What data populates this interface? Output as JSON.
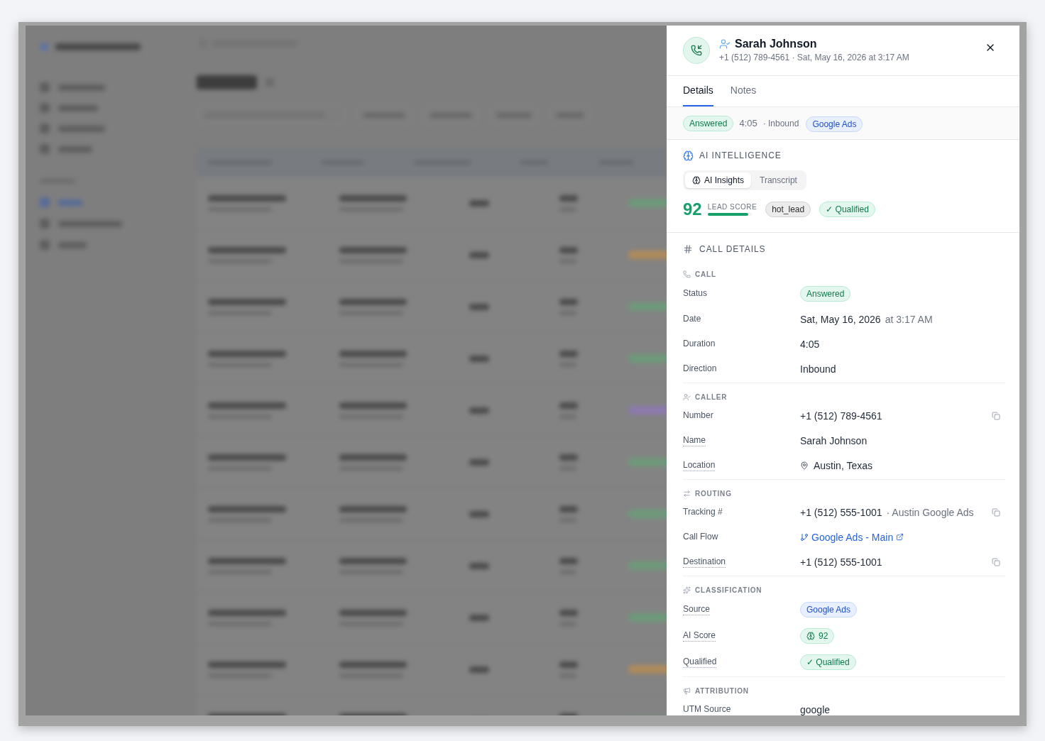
{
  "header": {
    "name": "Sarah Johnson",
    "subtitle": "+1 (512) 789-4561 · Sat, May 16, 2026 at 3:17 AM"
  },
  "tabs": [
    {
      "label": "Details",
      "selected": true
    },
    {
      "label": "Notes",
      "selected": false
    }
  ],
  "summary": {
    "status": "Answered",
    "duration": "4:05",
    "direction": "· Inbound",
    "source": "Google Ads"
  },
  "ai_intelligence": {
    "title": "AI INTELLIGENCE",
    "tabs": [
      {
        "kind": "insights",
        "label": "AI Insights",
        "selected": true
      },
      {
        "kind": "transcript",
        "label": "Transcript",
        "selected": false
      }
    ],
    "score": {
      "value": "92",
      "label": "LEAD SCORE",
      "level": 0.92
    },
    "tags": [
      {
        "kind": "tag",
        "text": "hot_lead"
      },
      {
        "kind": "status",
        "text": "✓ Qualified"
      }
    ]
  },
  "call_details": {
    "title": "CALL DETAILS",
    "groups": [
      {
        "title": "CALL",
        "rows": [
          {
            "label": "Status",
            "underlined": false,
            "copyable": false,
            "value": {
              "kind": "status_badge",
              "text": "Answered"
            }
          },
          {
            "label": "Date",
            "underlined": false,
            "copyable": false,
            "value": {
              "kind": "text",
              "text": "Sat, May 16, 2026",
              "note": "at 3:17 AM"
            }
          },
          {
            "label": "Duration",
            "underlined": false,
            "copyable": false,
            "value": {
              "kind": "text",
              "text": "4:05"
            }
          },
          {
            "label": "Direction",
            "underlined": false,
            "copyable": false,
            "value": {
              "kind": "text",
              "text": "Inbound"
            }
          }
        ]
      },
      {
        "title": "CALLER",
        "rows": [
          {
            "label": "Number",
            "underlined": false,
            "copyable": true,
            "value": {
              "kind": "text",
              "text": "+1 (512) 789-4561"
            }
          },
          {
            "label": "Name",
            "underlined": true,
            "copyable": false,
            "value": {
              "kind": "text",
              "text": "Sarah Johnson"
            }
          },
          {
            "label": "Location",
            "underlined": true,
            "copyable": false,
            "value": {
              "kind": "location",
              "text": "Austin, Texas"
            }
          }
        ]
      },
      {
        "title": "ROUTING",
        "rows": [
          {
            "label": "Tracking #",
            "underlined": false,
            "copyable": true,
            "value": {
              "kind": "text",
              "text": "+1 (512) 555-1001",
              "note": "· Austin Google Ads"
            }
          },
          {
            "label": "Call Flow",
            "underlined": false,
            "copyable": false,
            "value": {
              "kind": "link",
              "text": "Google Ads - Main"
            }
          },
          {
            "label": "Destination",
            "underlined": true,
            "copyable": true,
            "value": {
              "kind": "text",
              "text": "+1 (512) 555-1001"
            }
          }
        ]
      },
      {
        "title": "CLASSIFICATION",
        "rows": [
          {
            "label": "Source",
            "underlined": true,
            "copyable": false,
            "value": {
              "kind": "source_badge",
              "text": "Google Ads"
            }
          },
          {
            "label": "AI Score",
            "underlined": true,
            "copyable": false,
            "value": {
              "kind": "score",
              "text": "92"
            }
          },
          {
            "label": "Qualified",
            "underlined": true,
            "copyable": false,
            "value": {
              "kind": "status_badge",
              "text": "✓ Qualified"
            }
          }
        ]
      },
      {
        "title": "ATTRIBUTION",
        "rows": [
          {
            "label": "UTM Source",
            "underlined": false,
            "copyable": false,
            "value": {
              "kind": "text",
              "text": "google"
            }
          }
        ]
      }
    ]
  }
}
